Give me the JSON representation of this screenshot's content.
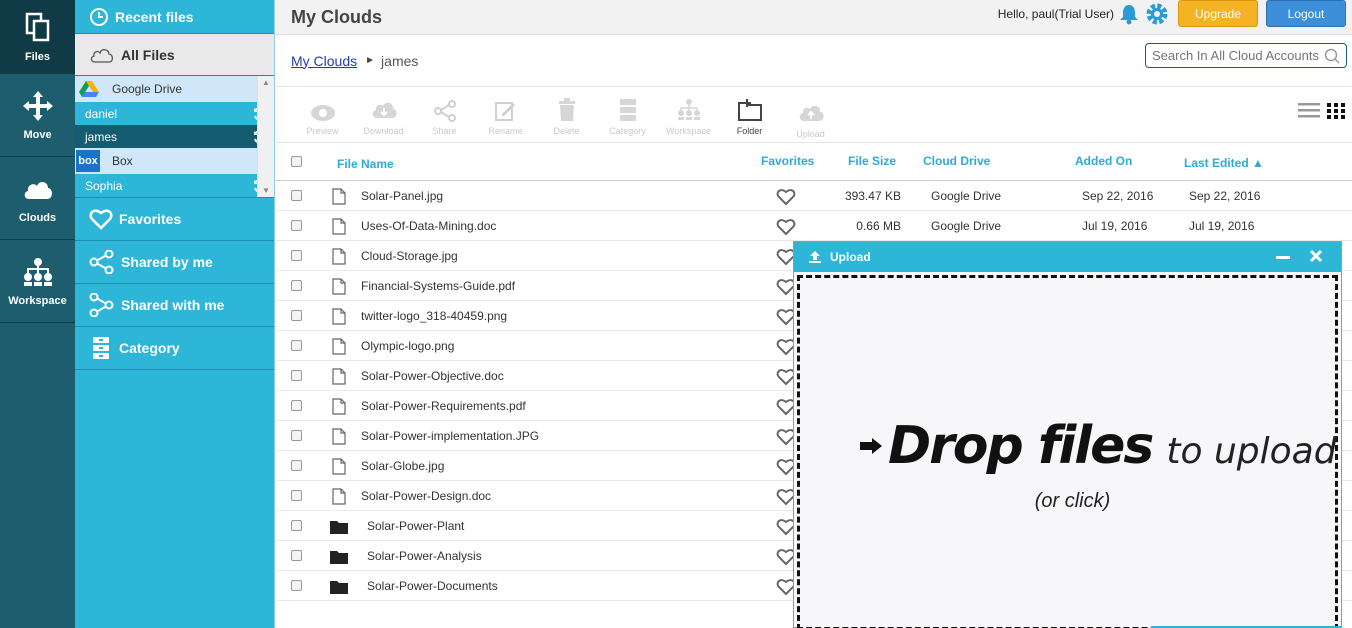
{
  "rail": {
    "items": [
      {
        "label": "Files",
        "icon": "files-icon",
        "active": true
      },
      {
        "label": "Move",
        "icon": "move-icon"
      },
      {
        "label": "Clouds",
        "icon": "cloud-icon"
      },
      {
        "label": "Workspace",
        "icon": "workspace-icon"
      }
    ]
  },
  "sidebar": {
    "recent": "Recent files",
    "all_files": "All Files",
    "clouds": [
      {
        "name": "Google Drive",
        "accounts": [
          "daniel",
          "james"
        ]
      },
      {
        "name": "Box",
        "accounts": [
          "Sophia"
        ]
      }
    ],
    "box_logo": "box",
    "favorites": "Favorites",
    "shared_by_me": "Shared by me",
    "shared_with_me": "Shared with me",
    "category": "Category"
  },
  "header": {
    "title": "My Clouds",
    "hello": "Hello, paul(Trial User)",
    "upgrade": "Upgrade",
    "logout": "Logout"
  },
  "breadcrumb": {
    "root": "My Clouds",
    "current": "james"
  },
  "search": {
    "placeholder": "Search In All Cloud Accounts"
  },
  "toolbar": {
    "preview": "Preview",
    "download": "Download",
    "share": "Share",
    "rename": "Rename",
    "delete": "Delete",
    "category": "Category",
    "workspace": "Workspace",
    "folder": "Folder",
    "upload": "Upload"
  },
  "table": {
    "headers": {
      "name": "File Name",
      "favorites": "Favorites",
      "size": "File Size",
      "drive": "Cloud Drive",
      "added": "Added On",
      "edited": "Last Edited ▲"
    },
    "rows": [
      {
        "name": "Solar-Panel.jpg",
        "type": "file",
        "size": "393.47 KB",
        "drive": "Google Drive",
        "added": "Sep 22, 2016",
        "edited": "Sep 22, 2016"
      },
      {
        "name": "Uses-Of-Data-Mining.doc",
        "type": "file",
        "size": "0.66 MB",
        "drive": "Google Drive",
        "added": "Jul 19, 2016",
        "edited": "Jul 19, 2016"
      },
      {
        "name": "Cloud-Storage.jpg",
        "type": "file"
      },
      {
        "name": "Financial-Systems-Guide.pdf",
        "type": "file"
      },
      {
        "name": "twitter-logo_318-40459.png",
        "type": "file"
      },
      {
        "name": "Olympic-logo.png",
        "type": "file"
      },
      {
        "name": "Solar-Power-Objective.doc",
        "type": "file"
      },
      {
        "name": "Solar-Power-Requirements.pdf",
        "type": "file"
      },
      {
        "name": "Solar-Power-implementation.JPG",
        "type": "file"
      },
      {
        "name": "Solar-Globe.jpg",
        "type": "file"
      },
      {
        "name": "Solar-Power-Design.doc",
        "type": "file"
      },
      {
        "name": "Solar-Power-Plant",
        "type": "folder"
      },
      {
        "name": "Solar-Power-Analysis",
        "type": "folder"
      },
      {
        "name": "Solar-Power-Documents",
        "type": "folder"
      }
    ]
  },
  "upload_modal": {
    "title": "Upload",
    "drop_bold": "Drop files",
    "drop_thin": "to upload",
    "drop_sub": "(or click)"
  },
  "colors": {
    "accent": "#2eb6d9",
    "rail": "#1d5d6e",
    "upgrade": "#f5b324",
    "logout": "#3d8fd9"
  }
}
